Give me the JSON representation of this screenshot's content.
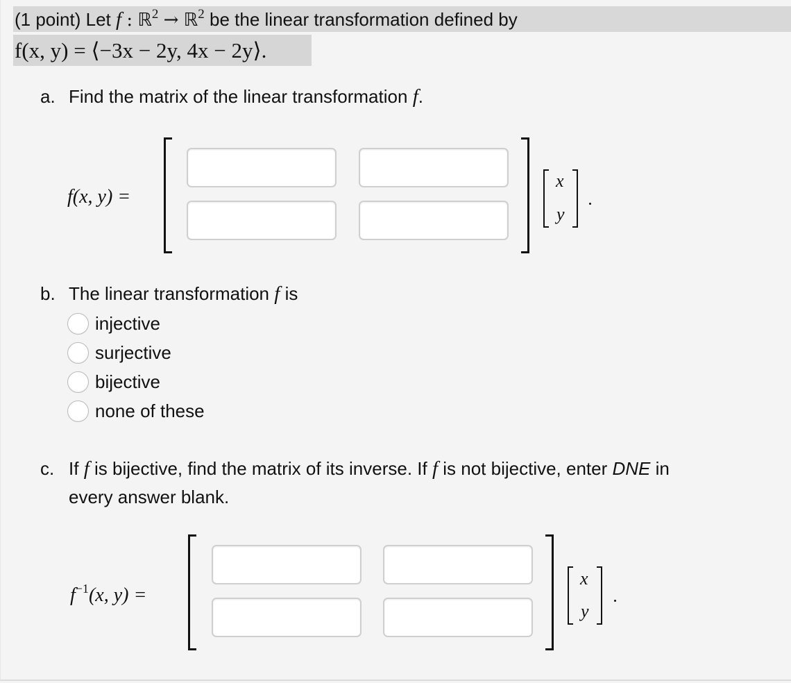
{
  "header": {
    "points": "(1 point)",
    "intro_let": "Let",
    "func": "f",
    "colon": ":",
    "domain": "ℝ",
    "domain_exp": "2",
    "arrow": "→",
    "codomain": "ℝ",
    "codomain_exp": "2",
    "intro_rest": "be the linear transformation defined by",
    "definition": "f(x, y) = ⟨−3x − 2y, 4x − 2y⟩."
  },
  "part_a": {
    "label": "a.",
    "text": "Find the matrix of the linear transformation",
    "func": "f",
    "end": ".",
    "lhs": "f(x, y) =",
    "vector": [
      "x",
      "y"
    ],
    "entries": [
      {
        "value": "",
        "placeholder": ""
      },
      {
        "value": "",
        "placeholder": ""
      },
      {
        "value": "",
        "placeholder": ""
      },
      {
        "value": "",
        "placeholder": ""
      }
    ]
  },
  "part_b": {
    "label": "b.",
    "text": "The linear transformation",
    "func": "f",
    "end": "is",
    "options": [
      {
        "label": "injective",
        "selected": false
      },
      {
        "label": "surjective",
        "selected": false
      },
      {
        "label": "bijective",
        "selected": false
      },
      {
        "label": "none of these",
        "selected": false
      }
    ]
  },
  "part_c": {
    "label": "c.",
    "text1": "If",
    "func": "f",
    "text2": "is bijective, find the matrix of its inverse. If",
    "text3": "is not bijective, enter",
    "dne": "DNE",
    "text4": "in",
    "text5": "every answer blank.",
    "lhs_func": "f",
    "lhs_exp": "−1",
    "lhs_rest": "(x, y) =",
    "vector": [
      "x",
      "y"
    ],
    "entries": [
      {
        "value": "",
        "placeholder": ""
      },
      {
        "value": "",
        "placeholder": ""
      },
      {
        "value": "",
        "placeholder": ""
      },
      {
        "value": "",
        "placeholder": ""
      }
    ]
  }
}
